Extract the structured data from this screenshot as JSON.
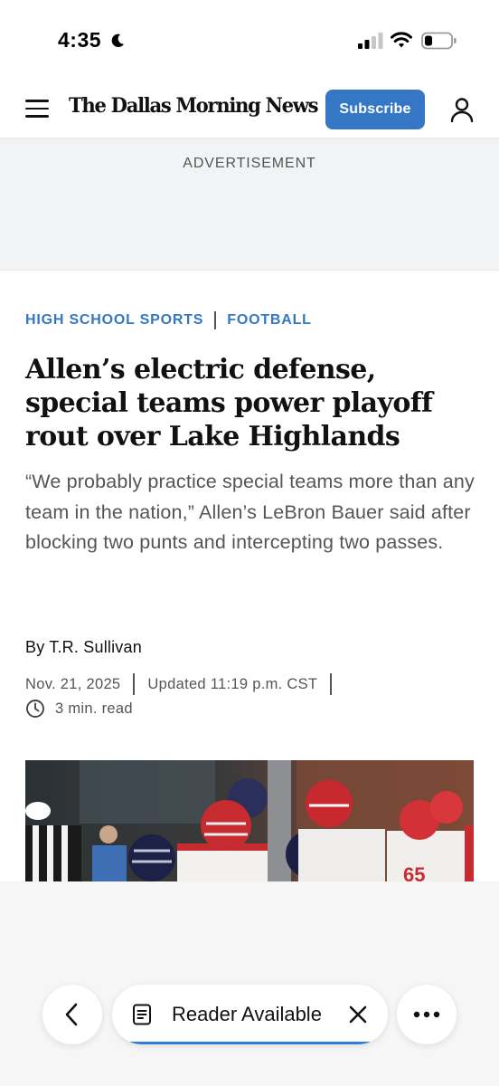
{
  "status_bar": {
    "time": "4:35",
    "icons": [
      "moon-icon",
      "cellular-signal-icon",
      "wifi-icon",
      "battery-icon"
    ]
  },
  "header": {
    "masthead": "The Dallas Morning News",
    "subscribe_label": "Subscribe",
    "menu_icon": "hamburger-menu-icon",
    "account_icon": "user-account-icon",
    "brand_color": "#3577c4"
  },
  "ad": {
    "label": "ADVERTISEMENT"
  },
  "article": {
    "section": "HIGH SCHOOL SPORTS",
    "subsection": "FOOTBALL",
    "headline": "Allen’s electric defense, special teams power playoff rout over Lake Highlands",
    "dek": "“We probably practice special teams more than any team in the nation,” Allen’s LeBron Bauer said after blocking two punts and intercepting two passes.",
    "byline": "By T.R. Sullivan",
    "date": "Nov. 21, 2025",
    "updated": "Updated 11:19 p.m. CST",
    "read_time": "3 min. read"
  },
  "browser_bar": {
    "reader_label": "Reader Available",
    "back_icon": "chevron-left-icon",
    "reader_icon": "document-icon",
    "close_icon": "close-icon",
    "more_icon": "more-dots-icon",
    "accent": "#2f7be0"
  }
}
